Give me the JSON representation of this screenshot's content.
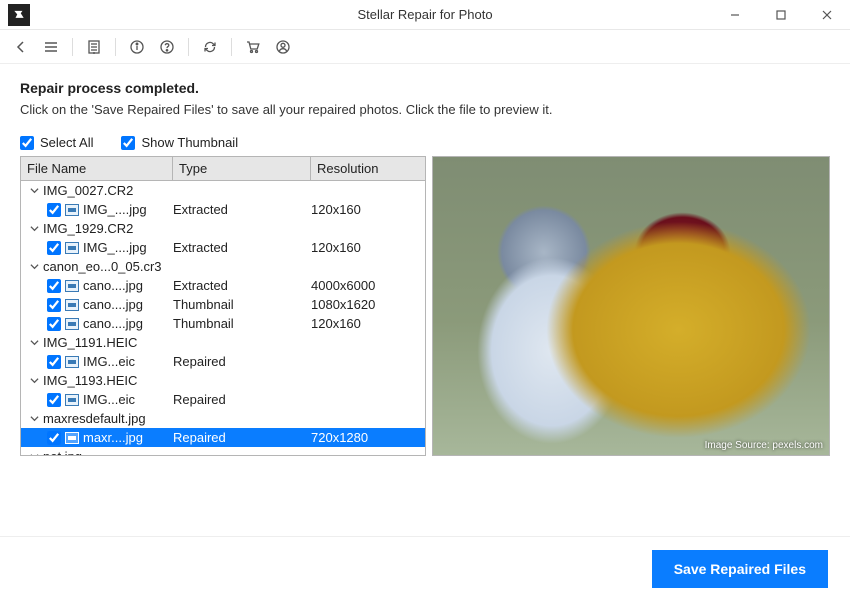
{
  "window": {
    "title": "Stellar Repair for Photo"
  },
  "status": {
    "heading": "Repair process completed.",
    "sub": "Click on the 'Save Repaired Files' to save all your repaired photos. Click the file to preview it."
  },
  "options": {
    "select_all": {
      "label": "Select All",
      "checked": true
    },
    "show_thumb": {
      "label": "Show Thumbnail",
      "checked": true
    }
  },
  "columns": {
    "name": "File Name",
    "type": "Type",
    "res": "Resolution"
  },
  "files": [
    {
      "kind": "group",
      "name": "IMG_0027.CR2",
      "children": [
        {
          "name": "IMG_....jpg",
          "type": "Extracted",
          "res": "120x160",
          "checked": true
        }
      ]
    },
    {
      "kind": "group",
      "name": "IMG_1929.CR2",
      "children": [
        {
          "name": "IMG_....jpg",
          "type": "Extracted",
          "res": "120x160",
          "checked": true
        }
      ]
    },
    {
      "kind": "group",
      "name": "canon_eo...0_05.cr3",
      "children": [
        {
          "name": "cano....jpg",
          "type": "Extracted",
          "res": "4000x6000",
          "checked": true
        },
        {
          "name": "cano....jpg",
          "type": "Thumbnail",
          "res": "1080x1620",
          "checked": true
        },
        {
          "name": "cano....jpg",
          "type": "Thumbnail",
          "res": "120x160",
          "checked": true
        }
      ]
    },
    {
      "kind": "group",
      "name": "IMG_1191.HEIC",
      "children": [
        {
          "name": "IMG...eic",
          "type": "Repaired",
          "res": "",
          "checked": true
        }
      ]
    },
    {
      "kind": "group",
      "name": "IMG_1193.HEIC",
      "children": [
        {
          "name": "IMG...eic",
          "type": "Repaired",
          "res": "",
          "checked": true
        }
      ]
    },
    {
      "kind": "group",
      "name": "maxresdefault.jpg",
      "children": [
        {
          "name": "maxr....jpg",
          "type": "Repaired",
          "res": "720x1280",
          "checked": true,
          "selected": true
        }
      ]
    },
    {
      "kind": "group",
      "name": "pet.jpg",
      "children": []
    }
  ],
  "preview": {
    "credit": "Image Source: pexels.com"
  },
  "buttons": {
    "save": "Save Repaired Files"
  }
}
